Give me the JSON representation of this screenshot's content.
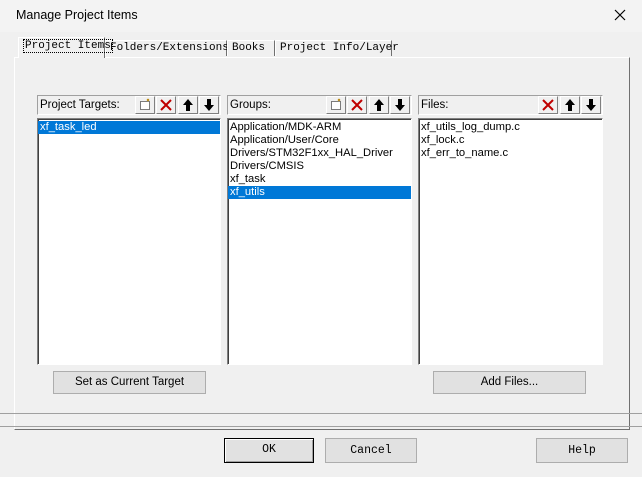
{
  "window": {
    "title": "Manage Project Items"
  },
  "tabs": [
    {
      "label": "Project Items"
    },
    {
      "label": "Folders/Extensions"
    },
    {
      "label": "Books"
    },
    {
      "label": "Project Info/Layer"
    }
  ],
  "targets": {
    "header": "Project Targets:",
    "items": [
      {
        "label": "xf_task_led",
        "selected": true
      }
    ]
  },
  "groups": {
    "header": "Groups:",
    "items": [
      {
        "label": "Application/MDK-ARM"
      },
      {
        "label": "Application/User/Core"
      },
      {
        "label": "Drivers/STM32F1xx_HAL_Driver"
      },
      {
        "label": "Drivers/CMSIS"
      },
      {
        "label": "xf_task"
      },
      {
        "label": "xf_utils",
        "selected": true
      }
    ]
  },
  "files": {
    "header": "Files:",
    "items": [
      {
        "label": "xf_utils_log_dump.c"
      },
      {
        "label": "xf_lock.c"
      },
      {
        "label": "xf_err_to_name.c"
      }
    ]
  },
  "buttons": {
    "set_target": "Set as Current Target",
    "add_files": "Add Files...",
    "ok": "OK",
    "cancel": "Cancel",
    "help": "Help"
  },
  "colors": {
    "selection": "#0078d7",
    "delete_red": "#c00000"
  }
}
